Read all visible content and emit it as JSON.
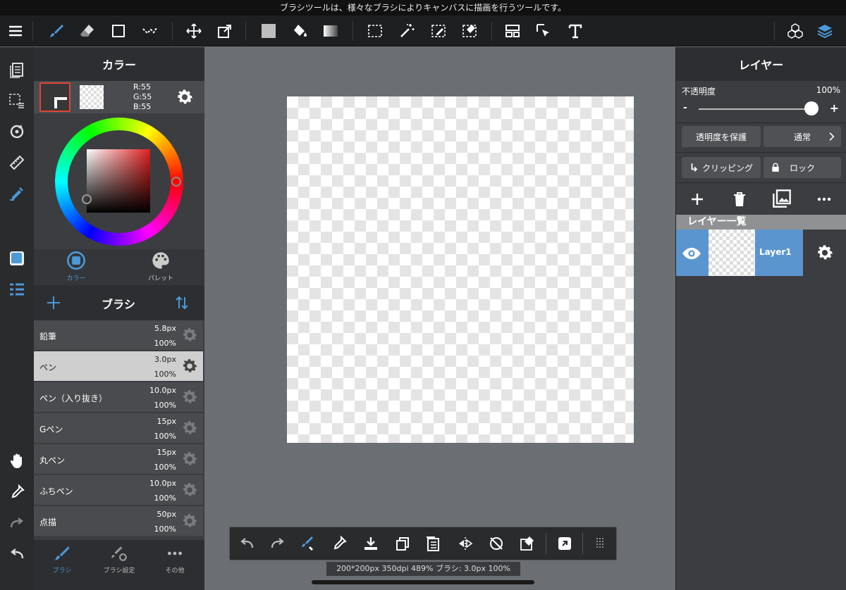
{
  "hint": "ブラシツールは、様々なブラシによりキャンバスに描画を行うツールです。",
  "color_panel": {
    "title": "カラー",
    "rgb": {
      "r": "R:55",
      "g": "G:55",
      "b": "B:55"
    },
    "tabs": [
      {
        "label": "カラー"
      },
      {
        "label": "パレット"
      }
    ]
  },
  "brush_panel": {
    "title": "ブラシ",
    "brushes": [
      {
        "name": "鉛筆",
        "size": "5.8px",
        "opacity": "100%"
      },
      {
        "name": "ペン",
        "size": "3.0px",
        "opacity": "100%"
      },
      {
        "name": "ペン（入り抜き）",
        "size": "10.0px",
        "opacity": "100%"
      },
      {
        "name": "Gペン",
        "size": "15px",
        "opacity": "100%"
      },
      {
        "name": "丸ペン",
        "size": "15px",
        "opacity": "100%"
      },
      {
        "name": "ふちペン",
        "size": "10.0px",
        "opacity": "100%"
      },
      {
        "name": "点描",
        "size": "50px",
        "opacity": "100%"
      }
    ],
    "selected_index": 1,
    "bottom_tabs": [
      {
        "label": "ブラシ"
      },
      {
        "label": "ブラシ設定"
      },
      {
        "label": "その他"
      }
    ]
  },
  "layer_panel": {
    "title": "レイヤー",
    "opacity_label": "不透明度",
    "opacity_value": "100%",
    "opacity_level": 1.0,
    "minus": "-",
    "plus": "+",
    "protect_alpha": "透明度を保護",
    "blend_mode": "通常",
    "clipping": "クリッピング",
    "lock": "ロック",
    "list_header": "レイヤー一覧",
    "layers": [
      {
        "name": "Layer1"
      }
    ]
  },
  "status": "200*200px 350dpi 489% ブラシ: 3.0px 100%",
  "colors": {
    "accent": "#4a9ad9",
    "selected_layer": "#5b95d0",
    "current_color": "#373737"
  }
}
